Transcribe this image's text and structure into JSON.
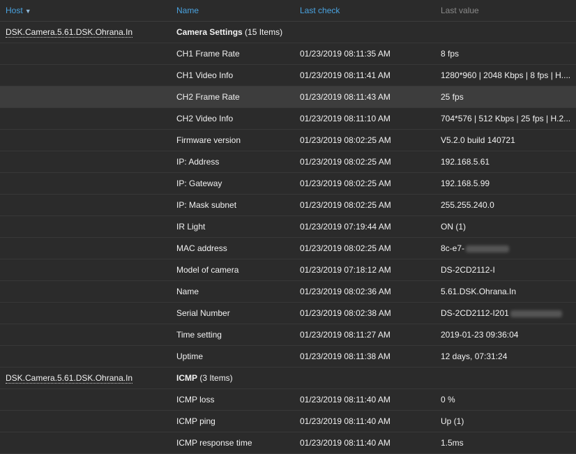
{
  "header": {
    "host": "Host",
    "name": "Name",
    "last_check": "Last check",
    "last_value": "Last value"
  },
  "groups": [
    {
      "host": "DSK.Camera.5.61.DSK.Ohrana.In",
      "title": "Camera Settings",
      "count": "(15 Items)",
      "items": [
        {
          "name": "CH1 Frame Rate",
          "check": "01/23/2019 08:11:35 AM",
          "value": "8 fps"
        },
        {
          "name": "CH1 Video Info",
          "check": "01/23/2019 08:11:41 AM",
          "value": "1280*960 | 2048 Kbps | 8 fps | H...."
        },
        {
          "name": "CH2 Frame Rate",
          "check": "01/23/2019 08:11:43 AM",
          "value": "25 fps"
        },
        {
          "name": "CH2 Video Info",
          "check": "01/23/2019 08:11:10 AM",
          "value": "704*576 | 512 Kbps | 25 fps | H.2..."
        },
        {
          "name": "Firmware version",
          "check": "01/23/2019 08:02:25 AM",
          "value": "V5.2.0 build 140721"
        },
        {
          "name": "IP: Address",
          "check": "01/23/2019 08:02:25 AM",
          "value": "192.168.5.61"
        },
        {
          "name": "IP: Gateway",
          "check": "01/23/2019 08:02:25 AM",
          "value": "192.168.5.99"
        },
        {
          "name": "IP: Mask subnet",
          "check": "01/23/2019 08:02:25 AM",
          "value": "255.255.240.0"
        },
        {
          "name": "IR Light",
          "check": "01/23/2019 07:19:44 AM",
          "value": "ON (1)"
        },
        {
          "name": "MAC address",
          "check": "01/23/2019 08:02:25 AM",
          "value": "8c-e7-"
        },
        {
          "name": "Model of camera",
          "check": "01/23/2019 07:18:12 AM",
          "value": "DS-2CD2112-I"
        },
        {
          "name": "Name",
          "check": "01/23/2019 08:02:36 AM",
          "value": "5.61.DSK.Ohrana.In"
        },
        {
          "name": "Serial Number",
          "check": "01/23/2019 08:02:38 AM",
          "value": "DS-2CD2112-I201"
        },
        {
          "name": "Time setting",
          "check": "01/23/2019 08:11:27 AM",
          "value": "2019-01-23 09:36:04"
        },
        {
          "name": "Uptime",
          "check": "01/23/2019 08:11:38 AM",
          "value": "12 days, 07:31:24"
        }
      ]
    },
    {
      "host": "DSK.Camera.5.61.DSK.Ohrana.In",
      "title": "ICMP",
      "count": "(3 Items)",
      "items": [
        {
          "name": "ICMP loss",
          "check": "01/23/2019 08:11:40 AM",
          "value": "0 %"
        },
        {
          "name": "ICMP ping",
          "check": "01/23/2019 08:11:40 AM",
          "value": "Up (1)"
        },
        {
          "name": "ICMP response time",
          "check": "01/23/2019 08:11:40 AM",
          "value": "1.5ms"
        }
      ]
    }
  ],
  "colors": {
    "background": "#2b2b2b",
    "hover_row": "#3d3d3d",
    "header_link": "#4aa3e0"
  },
  "icons": {
    "sort": "sort-descending-icon"
  }
}
